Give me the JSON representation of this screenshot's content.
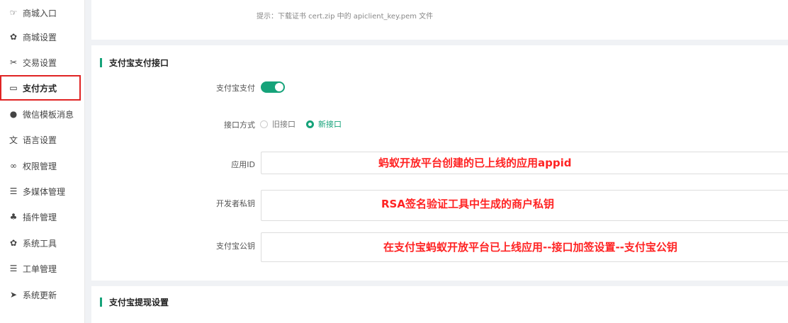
{
  "sidebar": {
    "items": [
      {
        "label": "商城入口",
        "icon": "hand-pointer-icon",
        "glyph": "☞"
      },
      {
        "label": "商城设置",
        "icon": "gear-icon",
        "glyph": "✿"
      },
      {
        "label": "交易设置",
        "icon": "wrench-icon",
        "glyph": "✂"
      },
      {
        "label": "支付方式",
        "icon": "credit-card-icon",
        "glyph": "▭"
      },
      {
        "label": "微信模板消息",
        "icon": "wechat-icon",
        "glyph": "●"
      },
      {
        "label": "语言设置",
        "icon": "language-icon",
        "glyph": "文"
      },
      {
        "label": "权限管理",
        "icon": "permission-icon",
        "glyph": "∞"
      },
      {
        "label": "多媒体管理",
        "icon": "list-icon",
        "glyph": "☰"
      },
      {
        "label": "插件管理",
        "icon": "plugin-icon",
        "glyph": "♣"
      },
      {
        "label": "系统工具",
        "icon": "gear-icon",
        "glyph": "✿"
      },
      {
        "label": "工单管理",
        "icon": "list-icon",
        "glyph": "☰"
      },
      {
        "label": "系统更新",
        "icon": "send-icon",
        "glyph": "➤"
      }
    ],
    "active_index": 3
  },
  "top_card": {
    "tip": "提示：下载证书 cert.zip 中的 apiclient_key.pem 文件"
  },
  "alipay_section": {
    "title": "支付宝支付接口",
    "alipay_pay_label": "支付宝支付",
    "alipay_pay_enabled": true,
    "interface_label": "接口方式",
    "old_interface": "旧接口",
    "new_interface": "新接口",
    "selected_interface": "新接口",
    "app_id_label": "应用ID",
    "app_id_value": "",
    "dev_private_key_label": "开发者私钥",
    "dev_private_key_value": "",
    "alipay_public_key_label": "支付宝公钥",
    "alipay_public_key_value": ""
  },
  "annotations": {
    "app_id": "蚂蚁开放平台创建的已上线的应用appid",
    "private_key": "RSA签名验证工具中生成的商户私钥",
    "public_key": "在支付宝蚂蚁开放平台已上线应用--接口加签设置--支付宝公钥"
  },
  "withdraw_section": {
    "title": "支付宝提现设置"
  },
  "colors": {
    "accent": "#16a37a",
    "annotation": "#ff2323",
    "highlight_border": "#e02424"
  }
}
